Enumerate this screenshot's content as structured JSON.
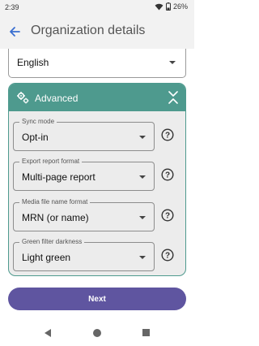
{
  "status_bar": {
    "time": "2:39",
    "battery": "26%"
  },
  "app_bar": {
    "title": "Organization details"
  },
  "language_select": {
    "value": "English"
  },
  "advanced": {
    "title": "Advanced",
    "fields": [
      {
        "label": "Sync mode",
        "value": "Opt-in"
      },
      {
        "label": "Export report format",
        "value": "Multi-page report"
      },
      {
        "label": "Media file name format",
        "value": "MRN (or name)"
      },
      {
        "label": "Green filter darkness",
        "value": "Light green"
      }
    ]
  },
  "next_button": {
    "label": "Next"
  },
  "colors": {
    "accent": "#4e9a8e",
    "primary_button": "#5f55a0",
    "app_bar_bg": "#f2f2f2"
  },
  "icons": [
    "wifi-icon",
    "battery-icon",
    "back-arrow-icon",
    "gear-icon",
    "chevron-collapse-icon",
    "help-icon",
    "nav-back-icon",
    "nav-home-icon",
    "nav-recents-icon"
  ]
}
